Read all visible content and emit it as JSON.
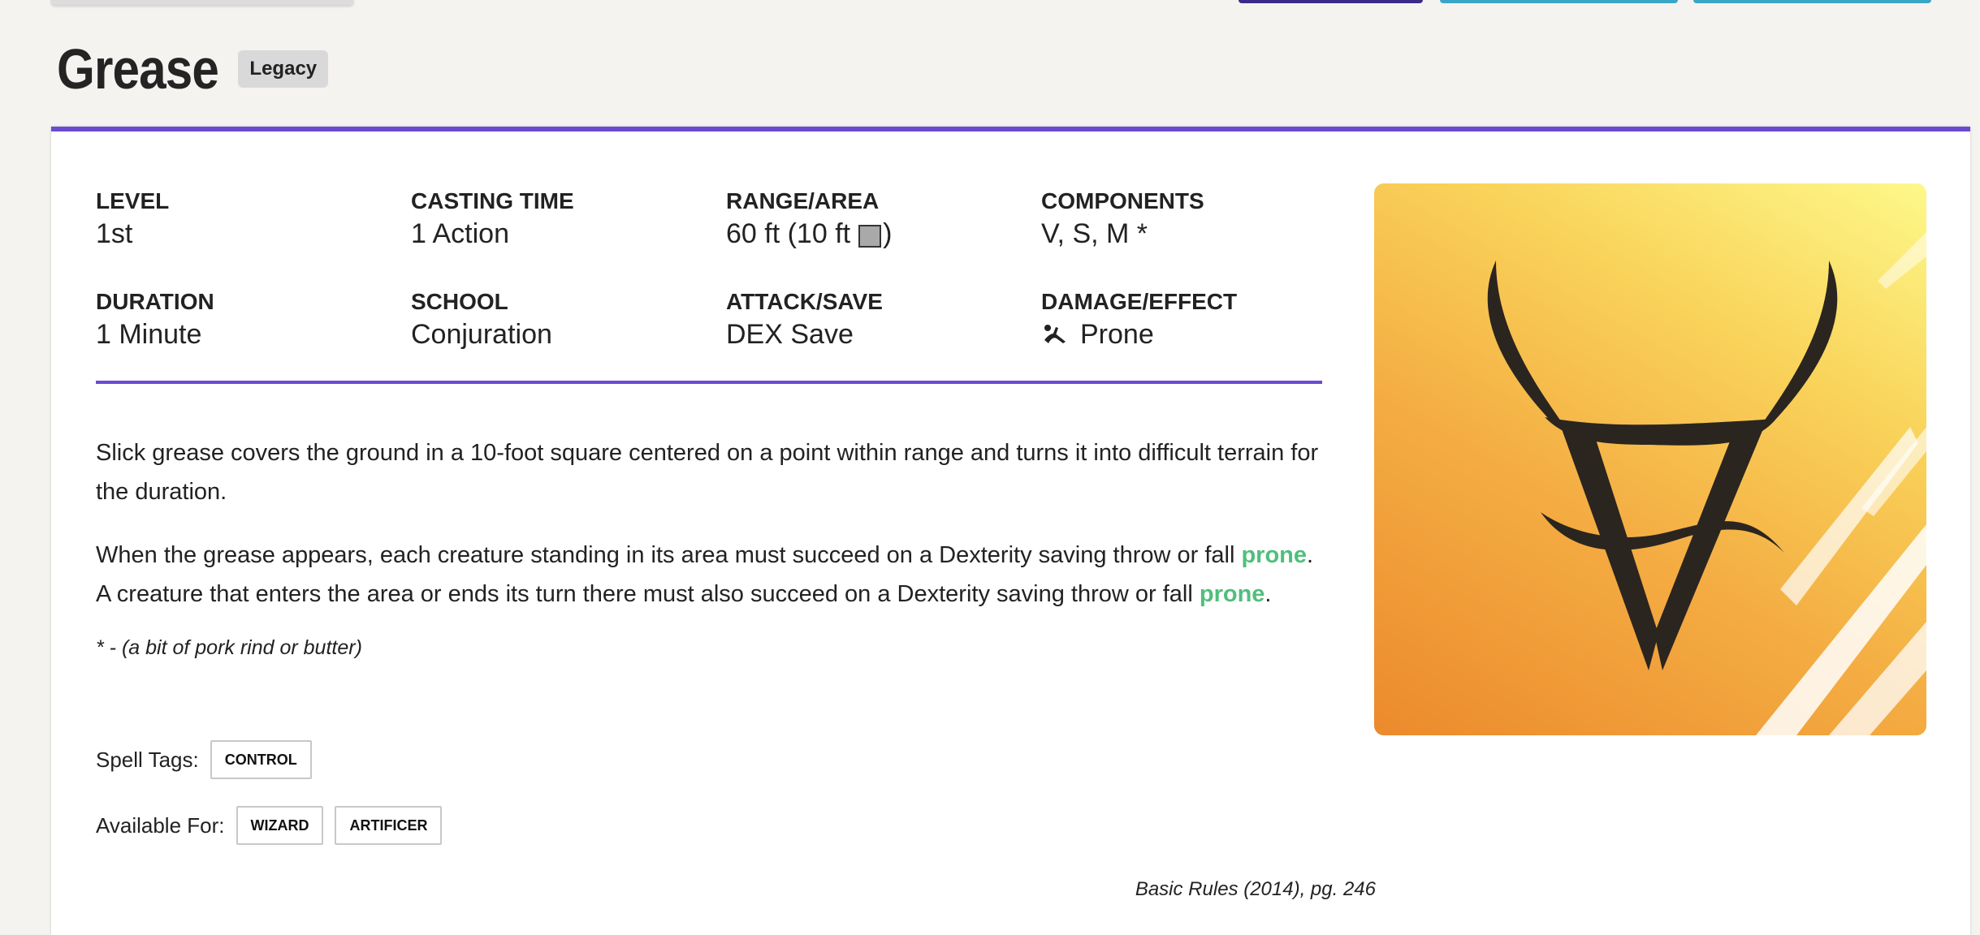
{
  "spell": {
    "name": "Grease",
    "badge": "Legacy"
  },
  "stats": [
    {
      "label": "LEVEL",
      "value": "1st"
    },
    {
      "label": "CASTING TIME",
      "value": "1 Action"
    },
    {
      "label": "RANGE/AREA",
      "value_prefix": "60 ft (10 ft",
      "value_suffix": ")",
      "icon": "square-area-icon"
    },
    {
      "label": "COMPONENTS",
      "value": "V, S, M *"
    },
    {
      "label": "DURATION",
      "value": "1 Minute"
    },
    {
      "label": "SCHOOL",
      "value": "Conjuration"
    },
    {
      "label": "ATTACK/SAVE",
      "value": "DEX Save"
    },
    {
      "label": "DAMAGE/EFFECT",
      "value": "Prone",
      "icon": "prone-icon"
    }
  ],
  "description": {
    "p1": "Slick grease covers the ground in a 10-foot square centered on a point within range and turns it into difficult terrain for the duration.",
    "p2_a": "When the grease appears, each creature standing in its area must succeed on a Dexterity saving throw or fall ",
    "p2_link1": "prone",
    "p2_b": ". A creature that enters the area or ends its turn there must also succeed on a Dexterity saving throw or fall ",
    "p2_link2": "prone",
    "p2_c": "."
  },
  "material": "* - (a bit of pork rind or butter)",
  "spell_tags": {
    "label": "Spell Tags:",
    "items": [
      "CONTROL"
    ]
  },
  "available_for": {
    "label": "Available For:",
    "items": [
      "WIZARD",
      "ARTIFICER"
    ]
  },
  "source": "Basic Rules (2014), pg. 246",
  "colors": {
    "accent": "#6a4bd0",
    "link": "#4fbf7c",
    "badge_bg": "#d9d9d9"
  },
  "image": {
    "icon": "conjuration-school-icon"
  }
}
